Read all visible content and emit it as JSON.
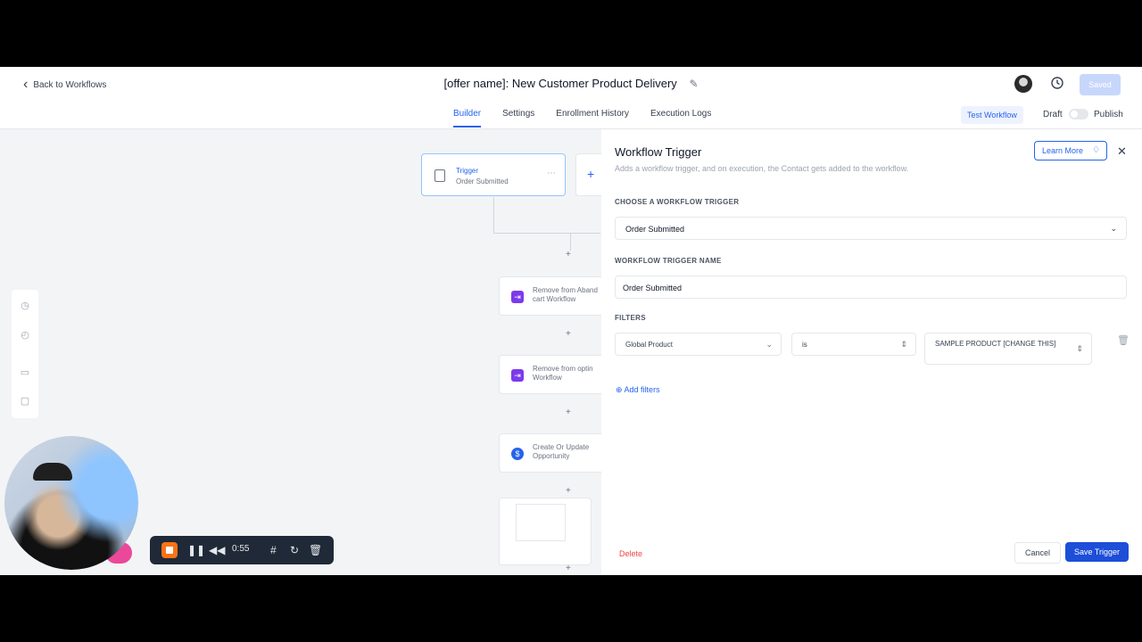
{
  "header": {
    "back_label": "Back to Workflows",
    "title": "[offer name]: New Customer Product Delivery",
    "saved_label": "Saved",
    "tabs": [
      {
        "label": "Builder"
      },
      {
        "label": "Settings"
      },
      {
        "label": "Enrollment History"
      },
      {
        "label": "Execution Logs"
      }
    ],
    "test_workflow_label": "Test Workflow",
    "draft_label": "Draft",
    "publish_label": "Publish",
    "published": false
  },
  "canvas": {
    "trigger_node": {
      "title": "Trigger",
      "subtitle": "Order Submitted"
    },
    "actions": [
      {
        "label": "Remove from Aband cart Workflow",
        "icon": "workflow-icon"
      },
      {
        "label": "Remove from optin Workflow",
        "icon": "workflow-icon"
      },
      {
        "label": "Create Or Update Opportunity",
        "icon": "opportunity-icon"
      }
    ]
  },
  "panel": {
    "title": "Workflow Trigger",
    "subtitle": "Adds a workflow trigger, and on execution, the Contact gets added to the workflow.",
    "learn_more_label": "Learn More",
    "choose_trigger_label": "CHOOSE A WORKFLOW TRIGGER",
    "trigger_value": "Order Submitted",
    "trigger_name_label": "WORKFLOW TRIGGER NAME",
    "trigger_name_value": "Order Submitted",
    "filters_label": "FILTERS",
    "filter": {
      "field": "Global Product",
      "operator": "is",
      "value": "SAMPLE PRODUCT [CHANGE THIS]"
    },
    "add_filters_label": "Add filters",
    "delete_label": "Delete",
    "cancel_label": "Cancel",
    "save_label": "Save Trigger"
  },
  "recorder": {
    "time": "0:55"
  },
  "colors": {
    "accent": "#2563eb",
    "save_button": "#1d4ed8",
    "delete_text": "#ef4444",
    "action_icon": "#7c3aed",
    "record_button": "#f97316"
  }
}
